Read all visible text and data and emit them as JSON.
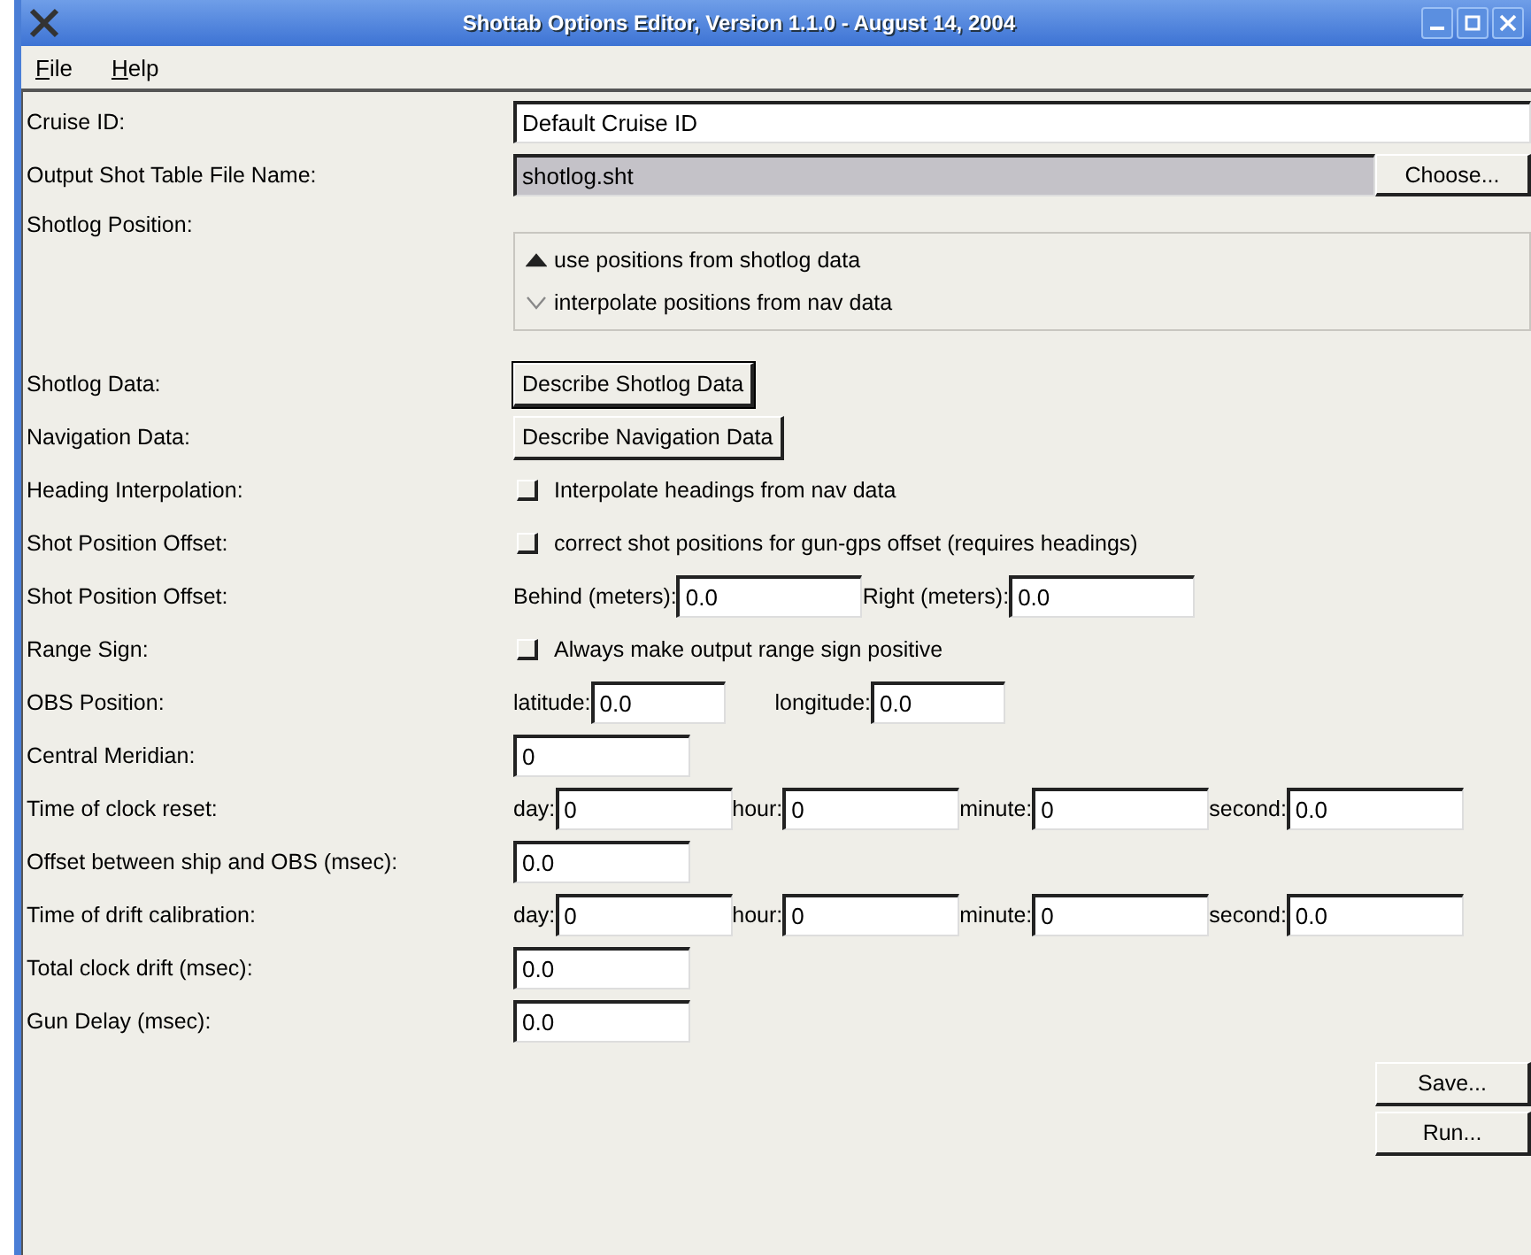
{
  "window": {
    "title": "Shottab Options Editor, Version 1.1.0 - August 14, 2004"
  },
  "menu": [
    {
      "label": "File"
    },
    {
      "label": "Help"
    }
  ],
  "rows": [
    {
      "kind": "text",
      "label": "Cruise ID:",
      "value": "Default Cruise ID"
    },
    {
      "kind": "file",
      "label": "Output Shot Table File Name:",
      "value": "shotlog.sht",
      "button": "Choose..."
    },
    {
      "kind": "radio",
      "label": "Shotlog Position:",
      "options": [
        {
          "label": "use positions from shotlog data",
          "selected": true
        },
        {
          "label": "interpolate positions from nav data",
          "selected": false
        }
      ]
    },
    {
      "kind": "button",
      "label": "Shotlog Data:",
      "button": "Describe Shotlog Data",
      "focused": true
    },
    {
      "kind": "button",
      "label": "Navigation Data:",
      "button": "Describe Navigation Data",
      "focused": false
    },
    {
      "kind": "checkbox",
      "label": "Heading Interpolation:",
      "text": "Interpolate headings from nav data",
      "checked": false
    },
    {
      "kind": "checkbox",
      "label": "Shot Position Offset:",
      "text": "correct shot positions for gun-gps offset (requires headings)",
      "checked": false
    },
    {
      "kind": "fields",
      "label": "Shot Position Offset:",
      "fields": [
        {
          "caption": "Behind (meters):",
          "value": "0.0"
        },
        {
          "caption": "Right (meters):",
          "value": "0.0"
        }
      ]
    },
    {
      "kind": "checkbox",
      "label": "Range Sign:",
      "text": "Always make output range sign positive",
      "checked": false
    },
    {
      "kind": "fields",
      "label": "OBS Position:",
      "fields": [
        {
          "caption": "latitude:",
          "value": "0.0"
        },
        {
          "caption": "longitude:",
          "value": "0.0"
        }
      ]
    },
    {
      "kind": "fields",
      "label": "Central Meridian:",
      "fields": [
        {
          "value": "0"
        }
      ]
    },
    {
      "kind": "fields",
      "label": "Time of clock reset:",
      "fields": [
        {
          "caption": "day:",
          "value": "0"
        },
        {
          "caption": "hour:",
          "value": "0"
        },
        {
          "caption": "minute:",
          "value": "0"
        },
        {
          "caption": "second:",
          "value": "0.0"
        }
      ]
    },
    {
      "kind": "fields",
      "label": "Offset between ship and OBS (msec):",
      "fields": [
        {
          "value": "0.0"
        }
      ]
    },
    {
      "kind": "fields",
      "label": "Time of drift calibration:",
      "fields": [
        {
          "caption": "day:",
          "value": "0"
        },
        {
          "caption": "hour:",
          "value": "0"
        },
        {
          "caption": "minute:",
          "value": "0"
        },
        {
          "caption": "second:",
          "value": "0.0"
        }
      ]
    },
    {
      "kind": "fields",
      "label": "Total clock drift (msec):",
      "fields": [
        {
          "value": "0.0"
        }
      ]
    },
    {
      "kind": "fields",
      "label": "Gun Delay (msec):",
      "fields": [
        {
          "value": "0.0"
        }
      ]
    }
  ],
  "actions": [
    {
      "label": "Save..."
    },
    {
      "label": "Run..."
    }
  ]
}
